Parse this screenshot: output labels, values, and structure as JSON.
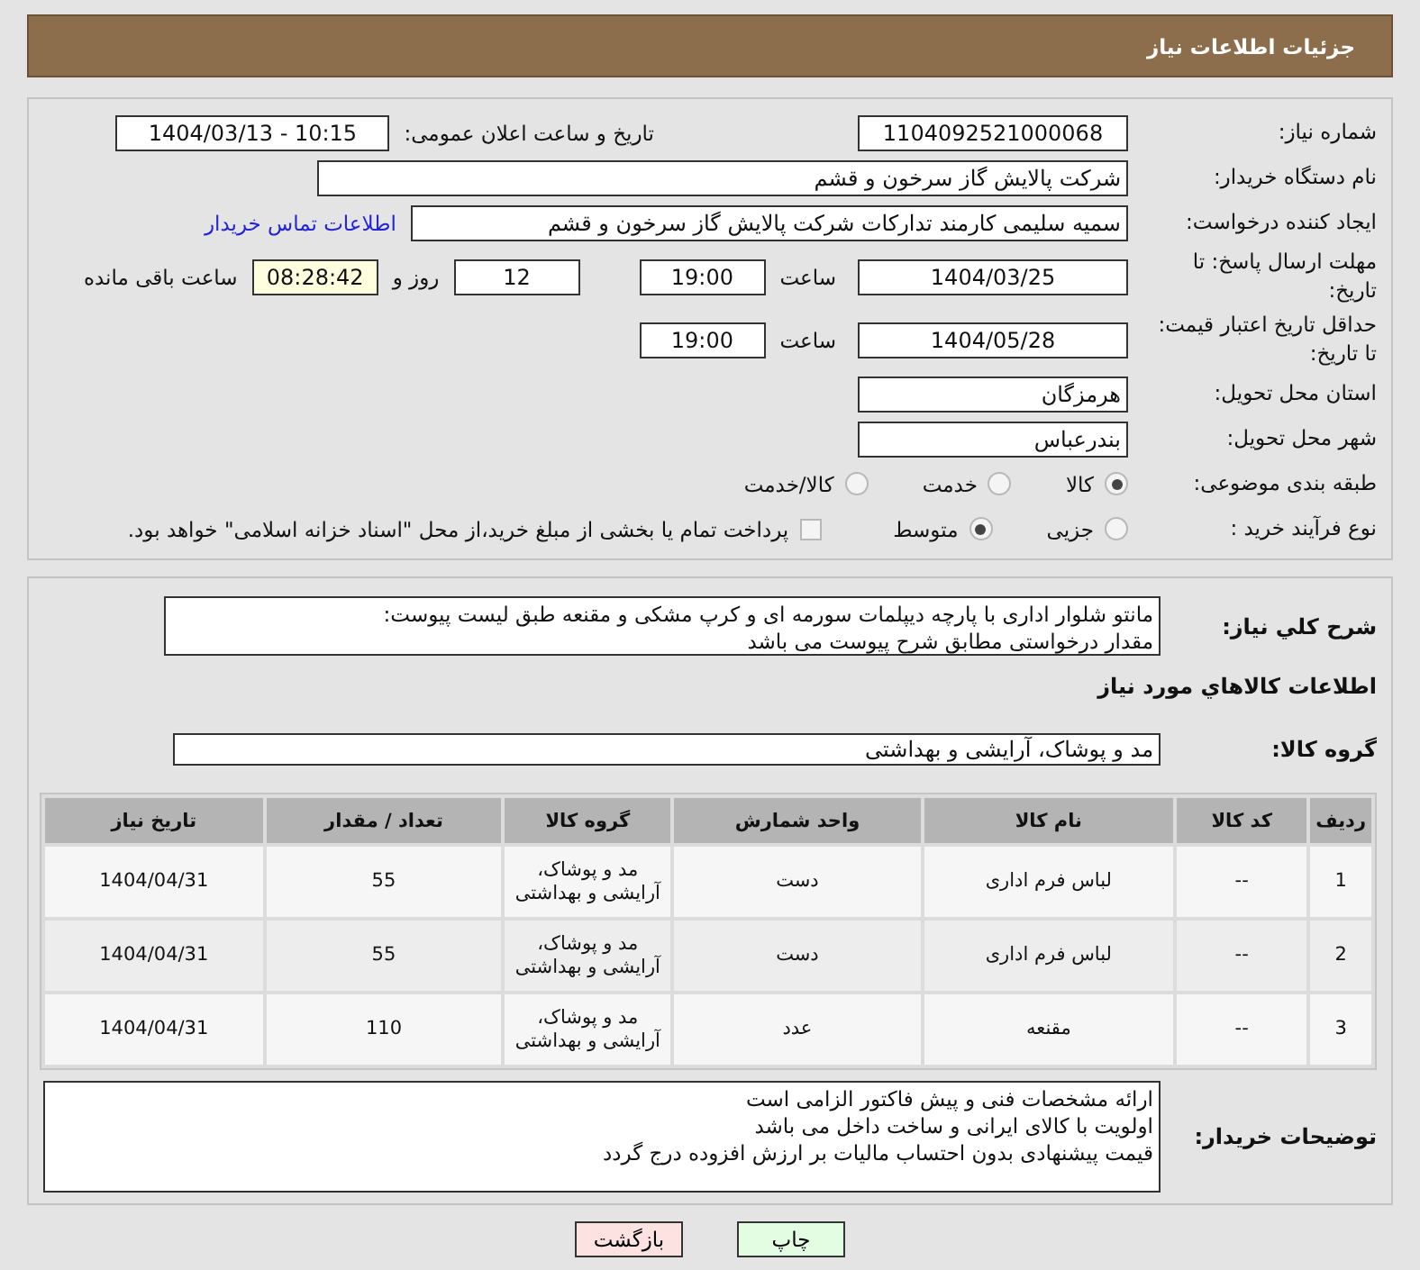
{
  "header": {
    "title": "جزئیات اطلاعات نیاز"
  },
  "need_number": {
    "label": "شماره نیاز:",
    "value": "1104092521000068"
  },
  "announce": {
    "label": "تاریخ و ساعت اعلان عمومی:",
    "value": "1404/03/13 - 10:15"
  },
  "buyer_org": {
    "label": "نام دستگاه خریدار:",
    "value": "شرکت پالایش گاز سرخون و قشم"
  },
  "requester": {
    "label": "ایجاد کننده درخواست:",
    "value": "سمیه سلیمی کارمند تدارکات شرکت پالایش گاز سرخون و قشم",
    "link": "اطلاعات تماس خریدار"
  },
  "reply_deadline": {
    "label": "مهلت ارسال پاسخ: تا تاریخ:",
    "date": "1404/03/25",
    "time_label": "ساعت",
    "time": "19:00",
    "days": "12",
    "days_label": "روز و",
    "remaining": "08:28:42",
    "remaining_label": "ساعت باقی مانده"
  },
  "price_validity": {
    "label": "حداقل تاریخ اعتبار قیمت: تا تاریخ:",
    "date": "1404/05/28",
    "time_label": "ساعت",
    "time": "19:00"
  },
  "province": {
    "label": "استان محل تحویل:",
    "value": "هرمزگان"
  },
  "city": {
    "label": "شهر محل تحویل:",
    "value": "بندرعباس"
  },
  "category": {
    "label": "طبقه بندی موضوعی:",
    "options": [
      {
        "label": "کالا",
        "selected": true
      },
      {
        "label": "خدمت",
        "selected": false
      },
      {
        "label": "کالا/خدمت",
        "selected": false
      }
    ]
  },
  "purchase_type": {
    "label": "نوع فرآیند خرید :",
    "options": [
      {
        "label": "جزیی",
        "selected": false
      },
      {
        "label": "متوسط",
        "selected": true
      }
    ],
    "payment_checkbox": {
      "checked": false,
      "label": "پرداخت تمام یا بخشی از مبلغ خرید،از محل \"اسناد خزانه اسلامی\" خواهد بود."
    }
  },
  "description": {
    "label": "شرح کلي نياز:",
    "lines": [
      "مانتو شلوار اداری با پارچه دیپلمات سورمه ای و کرپ مشکی و مقنعه طبق لیست پیوست:",
      "مقدار درخواستی مطابق شرح پیوست می باشد"
    ]
  },
  "goods_section_title": "اطلاعات کالاهاي مورد نياز",
  "goods_group": {
    "label": "گروه کالا:",
    "value": "مد و پوشاک، آرایشی و بهداشتی"
  },
  "table": {
    "columns": [
      "ردیف",
      "کد کالا",
      "نام کالا",
      "واحد شمارش",
      "گروه کالا",
      "تعداد / مقدار",
      "تاریخ نیاز"
    ],
    "rows": [
      [
        "1",
        "--",
        "لباس فرم اداری",
        "دست",
        "مد و پوشاک، آرایشی و بهداشتی",
        "55",
        "1404/04/31"
      ],
      [
        "2",
        "--",
        "لباس فرم اداری",
        "دست",
        "مد و پوشاک، آرایشی و بهداشتی",
        "55",
        "1404/04/31"
      ],
      [
        "3",
        "--",
        "مقنعه",
        "عدد",
        "مد و پوشاک، آرایشی و بهداشتی",
        "110",
        "1404/04/31"
      ]
    ]
  },
  "buyer_notes": {
    "label": "توضیحات خریدار:",
    "lines": [
      "ارائه مشخصات فنی و پیش فاکتور الزامی است",
      "اولویت با کالای ایرانی و ساخت داخل می باشد",
      "قیمت پیشنهادی بدون احتساب مالیات بر ارزش افزوده درج گردد"
    ]
  },
  "buttons": [
    {
      "label": "چاپ",
      "kind": "print"
    },
    {
      "label": "بازگشت",
      "kind": "back"
    }
  ]
}
